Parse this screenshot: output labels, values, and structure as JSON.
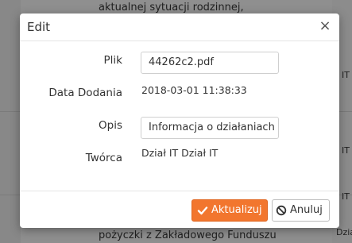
{
  "background": {
    "rows": [
      "aktualnej sytuacji rodzinnej,",
      "pożyczki z Zakładowego Funduszu"
    ],
    "side_labels": [
      "IT",
      "IT",
      "IT",
      "Dział IT"
    ]
  },
  "modal": {
    "title": "Edit",
    "close_symbol": "×",
    "fields": {
      "plik_label": "Plik",
      "plik_value": "44262c2.pdf",
      "data_label": "Data Dodania",
      "data_value": "2018-03-01 11:38:33",
      "opis_label": "Opis",
      "opis_value": "Informacja o działaniach",
      "tworca_label": "Twórca",
      "tworca_value": "Dział IT Dział IT"
    },
    "buttons": {
      "update_label": "Aktualizuj",
      "cancel_label": "Anuluj"
    }
  },
  "colors": {
    "primary": "#f2762e",
    "overlay": "#8f8f8f"
  },
  "icons": {
    "update": "check-icon",
    "cancel": "ban-icon",
    "close": "close-icon"
  }
}
